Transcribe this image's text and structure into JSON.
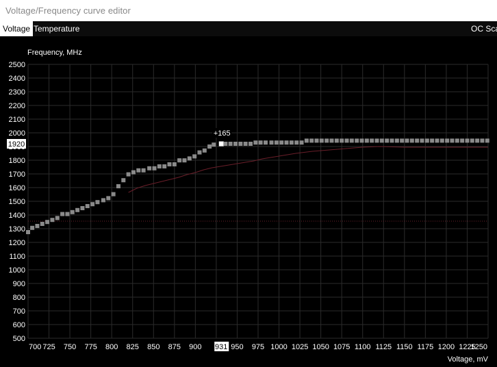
{
  "window": {
    "title": "Voltage/Frequency curve editor"
  },
  "tabs": [
    {
      "label": "Voltage",
      "active": true
    },
    {
      "label": "Temperature",
      "active": false
    },
    {
      "label": "OC Sca",
      "active": false
    }
  ],
  "colors": {
    "background": "#000000",
    "grid": "#2b2b2b",
    "curve_point": "#8a8a8a",
    "reference_line": "#6b1f2a",
    "highlight": "#ffffff"
  },
  "chart_data": {
    "type": "scatter",
    "ylabel": "Frequency, MHz",
    "xlabel": "Voltage, mV",
    "xlim": [
      700,
      1250
    ],
    "ylim": [
      500,
      2500
    ],
    "x_ticks": [
      700,
      725,
      750,
      775,
      800,
      825,
      850,
      875,
      900,
      925,
      950,
      975,
      1000,
      1025,
      1050,
      1075,
      1100,
      1125,
      1150,
      1175,
      1200,
      1225,
      1250
    ],
    "y_ticks": [
      500,
      600,
      700,
      800,
      900,
      1000,
      1100,
      1200,
      1300,
      1400,
      1500,
      1600,
      1700,
      1800,
      1900,
      2000,
      2100,
      2200,
      2300,
      2400,
      2500
    ],
    "x_tick_labels": [
      "700",
      "725",
      "750",
      "775",
      "800",
      "825",
      "850",
      "875",
      "900",
      "9",
      "950",
      "975",
      "1000",
      "1025",
      "1050",
      "1075",
      "1100",
      "1125",
      "1150",
      "1175",
      "1200",
      "1225",
      "1250"
    ],
    "grid": true,
    "cursor": {
      "voltage": 931,
      "frequency": 1920,
      "offset_label": "+165",
      "voltage_label": "931",
      "frequency_label": "1920"
    },
    "series": [
      {
        "points": [
          [
            700,
            1275
          ],
          [
            705,
            1306
          ],
          [
            711,
            1320
          ],
          [
            717,
            1335
          ],
          [
            723,
            1349
          ],
          [
            729,
            1364
          ],
          [
            735,
            1378
          ],
          [
            741,
            1407
          ],
          [
            747,
            1407
          ],
          [
            753,
            1421
          ],
          [
            759,
            1436
          ],
          [
            765,
            1450
          ],
          [
            771,
            1465
          ],
          [
            777,
            1479
          ],
          [
            783,
            1494
          ],
          [
            790,
            1508
          ],
          [
            796,
            1523
          ],
          [
            802,
            1552
          ],
          [
            808,
            1610
          ],
          [
            814,
            1654
          ],
          [
            820,
            1697
          ],
          [
            826,
            1712
          ],
          [
            832,
            1726
          ],
          [
            838,
            1726
          ],
          [
            845,
            1741
          ],
          [
            851,
            1741
          ],
          [
            857,
            1755
          ],
          [
            863,
            1755
          ],
          [
            869,
            1770
          ],
          [
            875,
            1770
          ],
          [
            881,
            1799
          ],
          [
            887,
            1799
          ],
          [
            893,
            1813
          ],
          [
            899,
            1828
          ],
          [
            905,
            1857
          ],
          [
            911,
            1871
          ],
          [
            917,
            1900
          ],
          [
            922,
            1914
          ],
          [
            931,
            1920
          ]
        ]
      },
      {
        "points": [
          [
            936,
            1920
          ],
          [
            942,
            1920
          ],
          [
            948,
            1920
          ],
          [
            954,
            1920
          ],
          [
            960,
            1920
          ],
          [
            966,
            1920
          ],
          [
            972,
            1929
          ],
          [
            978,
            1929
          ],
          [
            984,
            1929
          ],
          [
            991,
            1929
          ],
          [
            997,
            1929
          ],
          [
            1003,
            1929
          ],
          [
            1009,
            1929
          ],
          [
            1015,
            1929
          ],
          [
            1021,
            1929
          ],
          [
            1027,
            1929
          ],
          [
            1033,
            1943
          ],
          [
            1039,
            1943
          ],
          [
            1045,
            1943
          ],
          [
            1051,
            1943
          ],
          [
            1057,
            1943
          ],
          [
            1063,
            1943
          ],
          [
            1069,
            1943
          ],
          [
            1075,
            1943
          ],
          [
            1081,
            1943
          ],
          [
            1087,
            1943
          ],
          [
            1093,
            1943
          ],
          [
            1099,
            1943
          ],
          [
            1105,
            1943
          ],
          [
            1111,
            1943
          ],
          [
            1117,
            1943
          ],
          [
            1123,
            1943
          ],
          [
            1129,
            1943
          ],
          [
            1135,
            1943
          ],
          [
            1141,
            1943
          ],
          [
            1147,
            1943
          ],
          [
            1153,
            1943
          ],
          [
            1159,
            1943
          ],
          [
            1165,
            1943
          ],
          [
            1171,
            1943
          ],
          [
            1177,
            1943
          ],
          [
            1183,
            1943
          ],
          [
            1189,
            1943
          ],
          [
            1195,
            1943
          ],
          [
            1201,
            1943
          ],
          [
            1207,
            1943
          ],
          [
            1213,
            1943
          ],
          [
            1219,
            1943
          ],
          [
            1225,
            1943
          ],
          [
            1231,
            1943
          ],
          [
            1237,
            1943
          ],
          [
            1243,
            1943
          ],
          [
            1249,
            1943
          ]
        ]
      },
      {
        "points": [
          [
            820,
            1565
          ],
          [
            830,
            1595
          ],
          [
            840,
            1615
          ],
          [
            850,
            1630
          ],
          [
            860,
            1645
          ],
          [
            870,
            1660
          ],
          [
            880,
            1675
          ],
          [
            890,
            1695
          ],
          [
            900,
            1710
          ],
          [
            910,
            1730
          ],
          [
            920,
            1745
          ],
          [
            930,
            1755
          ],
          [
            940,
            1765
          ],
          [
            950,
            1775
          ],
          [
            960,
            1785
          ],
          [
            970,
            1795
          ],
          [
            980,
            1810
          ],
          [
            1000,
            1830
          ],
          [
            1020,
            1850
          ],
          [
            1040,
            1865
          ],
          [
            1060,
            1875
          ],
          [
            1080,
            1885
          ],
          [
            1100,
            1895
          ],
          [
            1120,
            1900
          ],
          [
            1150,
            1895
          ],
          [
            1200,
            1895
          ],
          [
            1250,
            1895
          ]
        ]
      }
    ],
    "reference_level": 1355
  }
}
